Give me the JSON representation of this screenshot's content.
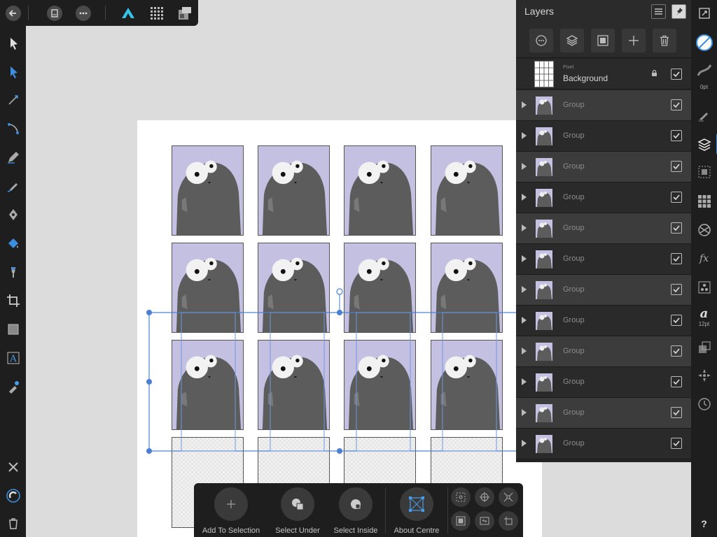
{
  "top_bar": {
    "back_icon": "back-arrow-icon",
    "document_icon": "document-icon",
    "more_icon": "more-icon",
    "persona_icon": "designer-persona-icon",
    "pixel_persona_icon": "pixel-persona-icon",
    "export_persona_icon": "export-persona-icon"
  },
  "left_tools": [
    "move-tool-icon",
    "node-tool-icon",
    "corner-tool-icon",
    "point-transform-icon",
    "pencil-tool-icon",
    "vector-brush-icon",
    "pen-tool-icon",
    "fill-tool-icon",
    "transparency-tool-icon",
    "crop-tool-icon",
    "shape-tool-icon",
    "text-tool-icon",
    "color-picker-icon"
  ],
  "left_bottom": [
    "close-icon",
    "snapping-icon",
    "trash-icon"
  ],
  "layers": {
    "title": "Layers",
    "background": {
      "kind": "Pixel",
      "name": "Background",
      "visible": true,
      "locked": true
    },
    "groups": [
      {
        "name": "Group",
        "visible": true
      },
      {
        "name": "Group",
        "visible": true
      },
      {
        "name": "Group",
        "visible": true
      },
      {
        "name": "Group",
        "visible": true
      },
      {
        "name": "Group",
        "visible": true
      },
      {
        "name": "Group",
        "visible": true
      },
      {
        "name": "Group",
        "visible": true
      },
      {
        "name": "Group",
        "visible": true
      },
      {
        "name": "Group",
        "visible": true
      },
      {
        "name": "Group",
        "visible": true
      },
      {
        "name": "Group",
        "visible": true
      },
      {
        "name": "Group",
        "visible": true
      }
    ]
  },
  "right_strip": {
    "stroke_width": "0pt",
    "font_size": "12pt",
    "help": "?"
  },
  "bottom_bar": {
    "add_to_selection": "Add To Selection",
    "select_under": "Select Under",
    "select_inside": "Select Inside",
    "about_centre": "About Centre"
  },
  "colors": {
    "card_bg": "#c4c0e2",
    "selection": "#4a7fd4",
    "panel_bg": "#232323"
  }
}
